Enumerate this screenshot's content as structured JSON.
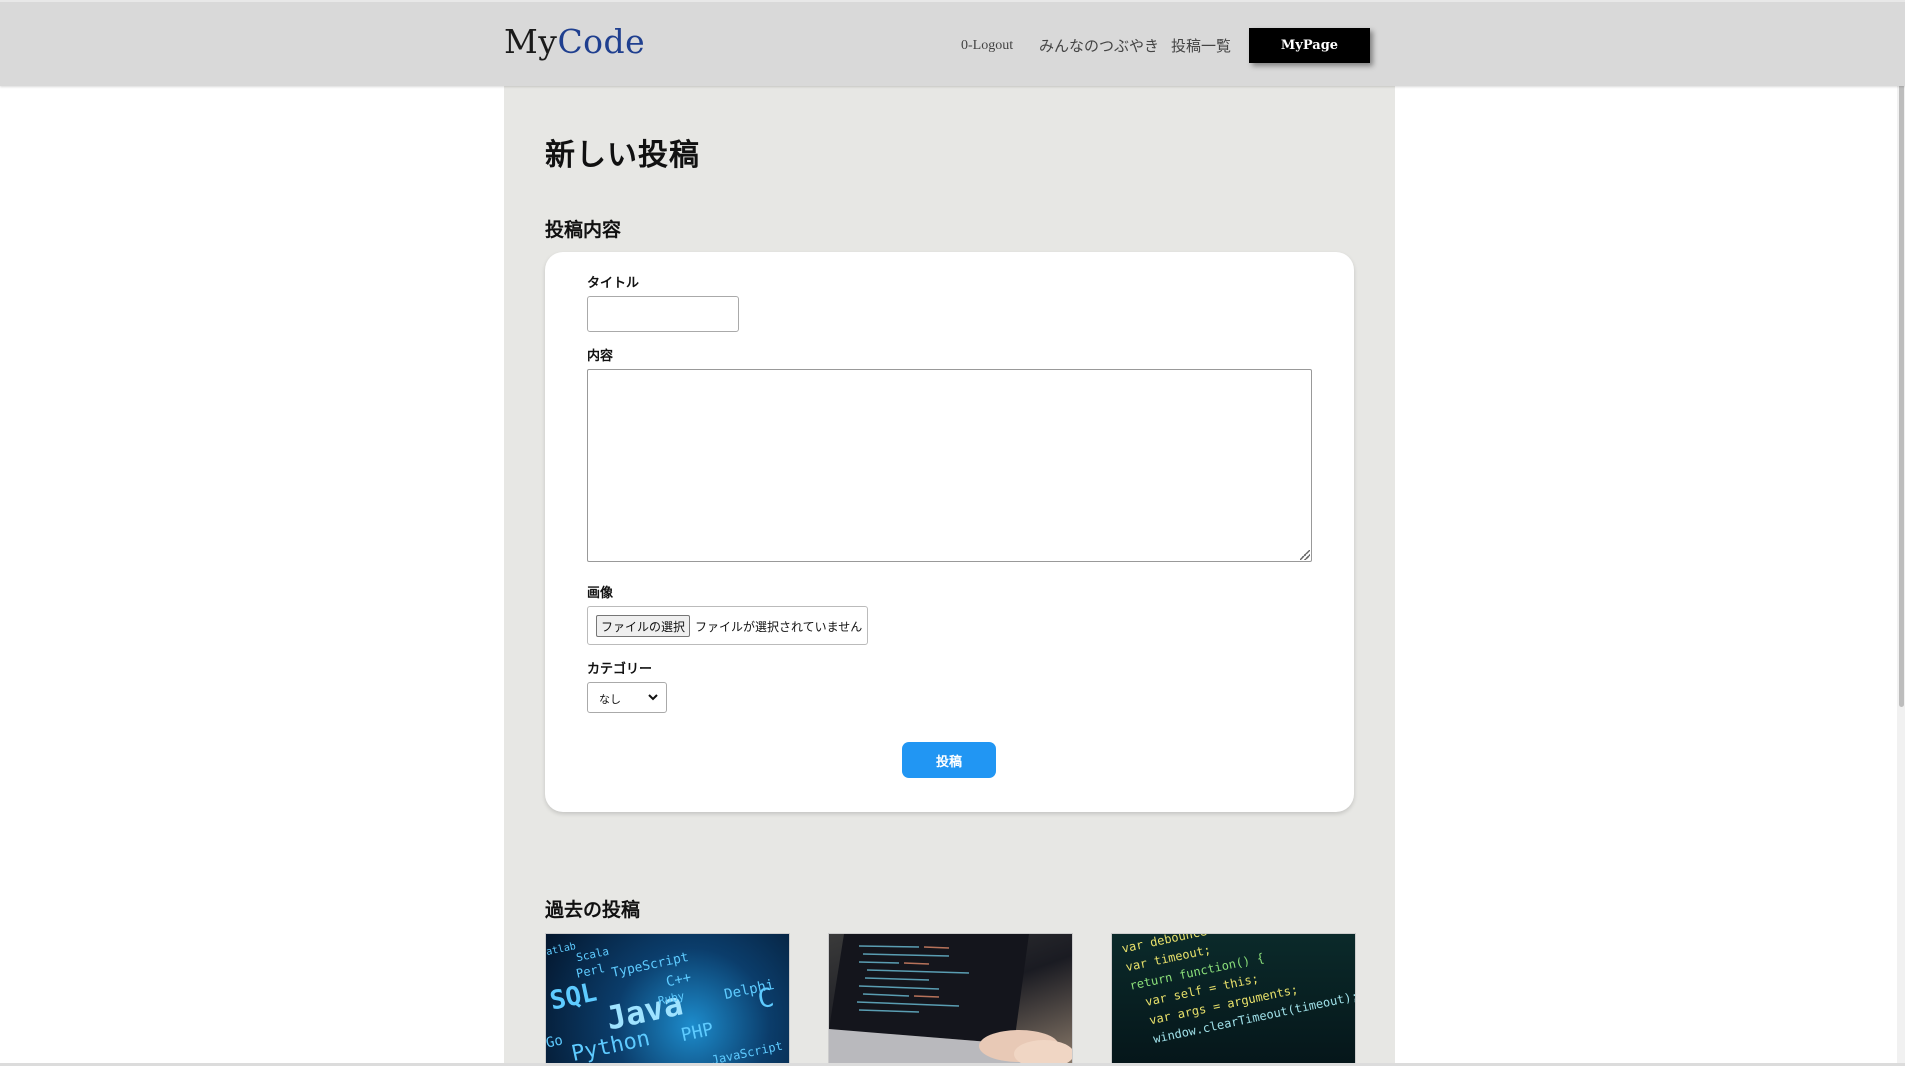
{
  "header": {
    "logo_my": "My",
    "logo_code": "Code",
    "nav_logout": "0-Logout",
    "nav_tsubuyaki": "みんなのつぶやき",
    "nav_posts": "投稿一覧",
    "mypage_label": "MyPage"
  },
  "main": {
    "page_title": "新しい投稿",
    "form_section_title": "投稿内容",
    "form": {
      "title_label": "タイトル",
      "title_value": "",
      "content_label": "内容",
      "content_value": "",
      "image_label": "画像",
      "file_button": "ファイルの選択",
      "file_status": "ファイルが選択されていません",
      "category_label": "カテゴリー",
      "category_selected": "なし",
      "submit_label": "投稿"
    },
    "past_section_title": "過去の投稿",
    "thumbnails": [
      {
        "icon": "programming-languages-image",
        "words": [
          "Scala",
          "Perl",
          "TypeScript",
          "SQL",
          "Java",
          "C++",
          "Ruby",
          "PHP",
          "Python",
          "Go",
          "JavaScript",
          "Delphi",
          "C",
          "atlab"
        ]
      },
      {
        "icon": "laptop-coding-image"
      },
      {
        "icon": "code-editor-image",
        "code_lines": [
          "var debounce = function(fn, delay) {",
          "var timeout;",
          "return function() {",
          "var self = this;",
          "var args = arguments;",
          "window.clearTimeout(timeout);"
        ]
      }
    ]
  },
  "colors": {
    "header_bg": "#d9d9d9",
    "main_bg": "#e7e7e4",
    "logo_accent": "#1f3f8f",
    "submit_bg": "#2196f3",
    "mypage_bg": "#000000"
  }
}
